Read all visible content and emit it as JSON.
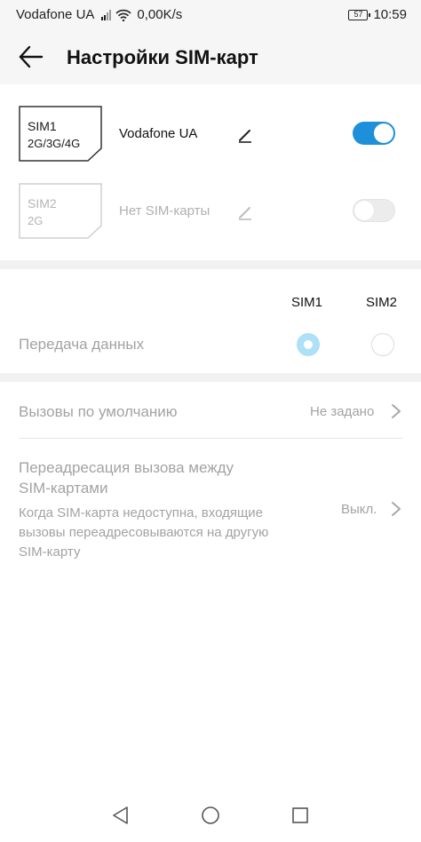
{
  "status_bar": {
    "carrier": "Vodafone UA",
    "speed": "0,00K/s",
    "battery": "57",
    "time": "10:59"
  },
  "header": {
    "title": "Настройки SIM-карт",
    "back_icon": "arrow-left-icon"
  },
  "sims": [
    {
      "slot": "SIM1",
      "network": "2G/3G/4G",
      "label": "Vodafone UA",
      "enabled": true,
      "active": true
    },
    {
      "slot": "SIM2",
      "network": "2G",
      "label": "Нет SIM-карты",
      "enabled": false,
      "active": false
    }
  ],
  "data_transfer": {
    "columns": [
      "SIM1",
      "SIM2"
    ],
    "label": "Передача данных",
    "selected": "SIM1"
  },
  "default_calls": {
    "label": "Вызовы по умолчанию",
    "value": "Не задано"
  },
  "call_forwarding": {
    "title_line1": "Переадресация вызова между",
    "title_line2": "SIM-картами",
    "desc_line1": "Когда SIM-карта недоступна, входящие",
    "desc_line2": "вызовы переадресовываются на другую",
    "desc_line3": "SIM-карту",
    "value": "Выкл."
  },
  "colors": {
    "accent": "#1e8fd9",
    "accent_light": "#aee0f8",
    "disabled_text": "#a3a3a3",
    "disabled_border": "#cfcfcf"
  },
  "nav": {
    "back_icon": "triangle-back-icon",
    "home_icon": "circle-home-icon",
    "recent_icon": "square-recent-icon"
  }
}
